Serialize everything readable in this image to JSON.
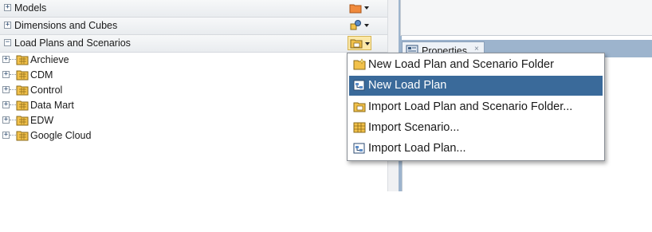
{
  "navigator": {
    "accordions": [
      {
        "label": "Models",
        "expander": "+",
        "icon": "models-folder-icon"
      },
      {
        "label": "Dimensions and Cubes",
        "expander": "+",
        "icon": "dimensions-cube-icon"
      },
      {
        "label": "Load Plans and Scenarios",
        "expander": "−",
        "icon": "load-plan-folder-icon"
      }
    ],
    "tree_items": [
      {
        "label": "Archieve",
        "expander": "+"
      },
      {
        "label": "CDM",
        "expander": "+"
      },
      {
        "label": "Control",
        "expander": "+"
      },
      {
        "label": "Data Mart",
        "expander": "+"
      },
      {
        "label": "EDW",
        "expander": "+"
      },
      {
        "label": "Google Cloud",
        "expander": "+"
      }
    ]
  },
  "properties_tab": {
    "label": "Properties",
    "close": "×"
  },
  "context_menu": {
    "items": [
      {
        "label": "New Load Plan and Scenario Folder",
        "icon": "new-folder-icon",
        "highlighted": false
      },
      {
        "label": "New Load Plan",
        "icon": "new-load-plan-icon",
        "highlighted": true
      },
      {
        "label": "Import Load Plan and Scenario Folder...",
        "icon": "import-folder-icon",
        "highlighted": false
      },
      {
        "label": "Import Scenario...",
        "icon": "import-scenario-icon",
        "highlighted": false
      },
      {
        "label": "Import Load Plan...",
        "icon": "import-load-plan-icon",
        "highlighted": false
      }
    ]
  },
  "colors": {
    "menu_highlight": "#3a6a9a",
    "folder_yellow": "#f2c14a",
    "panel_blue": "#9db4cd"
  }
}
